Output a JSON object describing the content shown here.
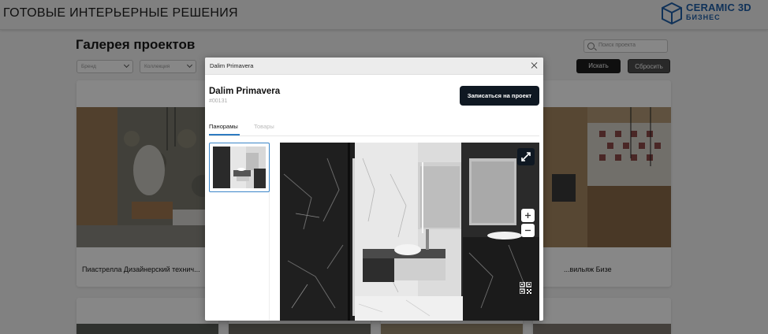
{
  "site": {
    "title": "ГОТОВЫЕ ИНТЕРЬЕРНЫЕ РЕШЕНИЯ",
    "logo_line1": "CERAMIC 3D",
    "logo_line2": "БИЗНЕС"
  },
  "gallery": {
    "title": "Галерея проектов",
    "search_placeholder": "Поиск проекта",
    "filter_brand": "Бренд",
    "filter_collection": "Коллекция",
    "search_button": "Искать",
    "reset_button": "Сбросить",
    "card_left_label": "Пиастрелла Дизайнерский технич...",
    "card_right_label": "...вильяж Бизе"
  },
  "modal": {
    "header_title": "Dalim Primavera",
    "project_name": "Dalim Primavera",
    "project_code": "#00131",
    "book_button": "Записаться на проект",
    "tabs": [
      {
        "label": "Панорамы",
        "active": true
      },
      {
        "label": "Товары",
        "active": false
      }
    ]
  },
  "colors": {
    "accent": "#2d7bc2",
    "primary_dark": "#0f1822",
    "brand_blue": "#1f5fa8"
  }
}
